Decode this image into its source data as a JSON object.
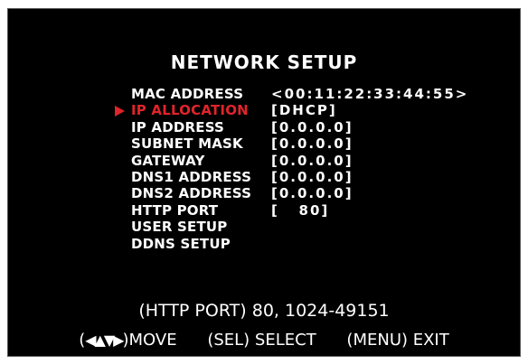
{
  "title": "NETWORK SETUP",
  "menu": {
    "selected_index": 1,
    "rows": [
      {
        "label": "MAC ADDRESS",
        "value": "<00:11:22:33:44:55>"
      },
      {
        "label": "IP ALLOCATION",
        "value": "[DHCP]"
      },
      {
        "label": "IP ADDRESS",
        "value": "[0.0.0.0]"
      },
      {
        "label": "SUBNET MASK",
        "value": "[0.0.0.0]"
      },
      {
        "label": "GATEWAY",
        "value": "[0.0.0.0]"
      },
      {
        "label": "DNS1 ADDRESS",
        "value": "[0.0.0.0]"
      },
      {
        "label": "DNS2 ADDRESS",
        "value": "[0.0.0.0]"
      },
      {
        "label": "HTTP PORT",
        "value": "[   80]"
      },
      {
        "label": "USER SETUP",
        "value": ""
      },
      {
        "label": "DDNS SETUP",
        "value": ""
      }
    ]
  },
  "hint": "(HTTP PORT) 80, 1024-49151",
  "footer": {
    "move_open": "(",
    "move_arrows": "◀▲▼▶",
    "move_close": ")",
    "move_label": "MOVE",
    "select": "(SEL) SELECT",
    "exit": "(MENU) EXIT"
  },
  "colors": {
    "background": "#000000",
    "text": "#ffffff",
    "highlight": "#e0242a"
  }
}
